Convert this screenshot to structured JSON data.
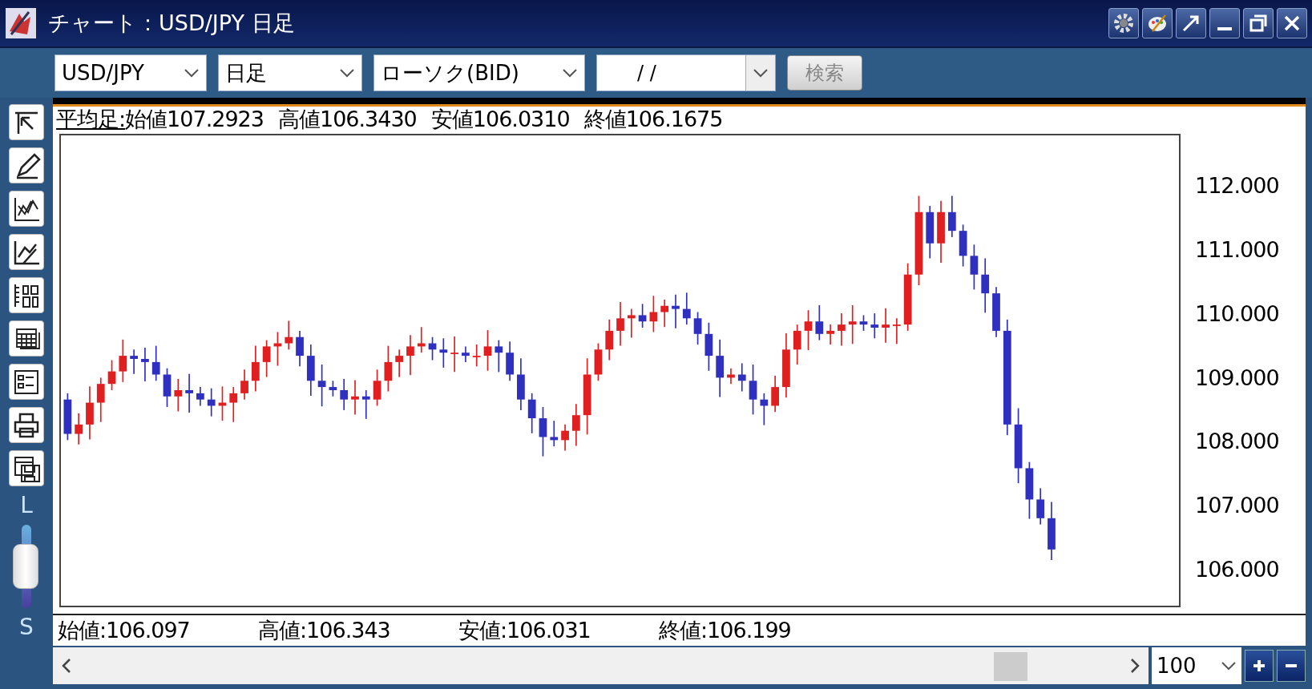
{
  "window": {
    "title": "チャート：USD/JPY 日足"
  },
  "toolbar": {
    "symbol": "USD/JPY",
    "period": "日足",
    "chart_type": "ローソク(BID)",
    "date": "/ /",
    "search_button": "検索"
  },
  "info_line": {
    "label": "平均足:",
    "values": [
      "始値107.2923",
      "高値106.3430",
      "安値106.0310",
      "終値106.1675"
    ]
  },
  "price_axis": [
    "112.000",
    "111.000",
    "110.000",
    "109.000",
    "108.000",
    "107.000",
    "106.000"
  ],
  "ohlc_footer": [
    "始値:106.097",
    "高値:106.343",
    "安値:106.031",
    "終値:106.199"
  ],
  "side_panel": {
    "top_label": "L",
    "bottom_label": "S",
    "slider": {
      "level": 0.5
    }
  },
  "zoom": {
    "value": "100"
  }
}
